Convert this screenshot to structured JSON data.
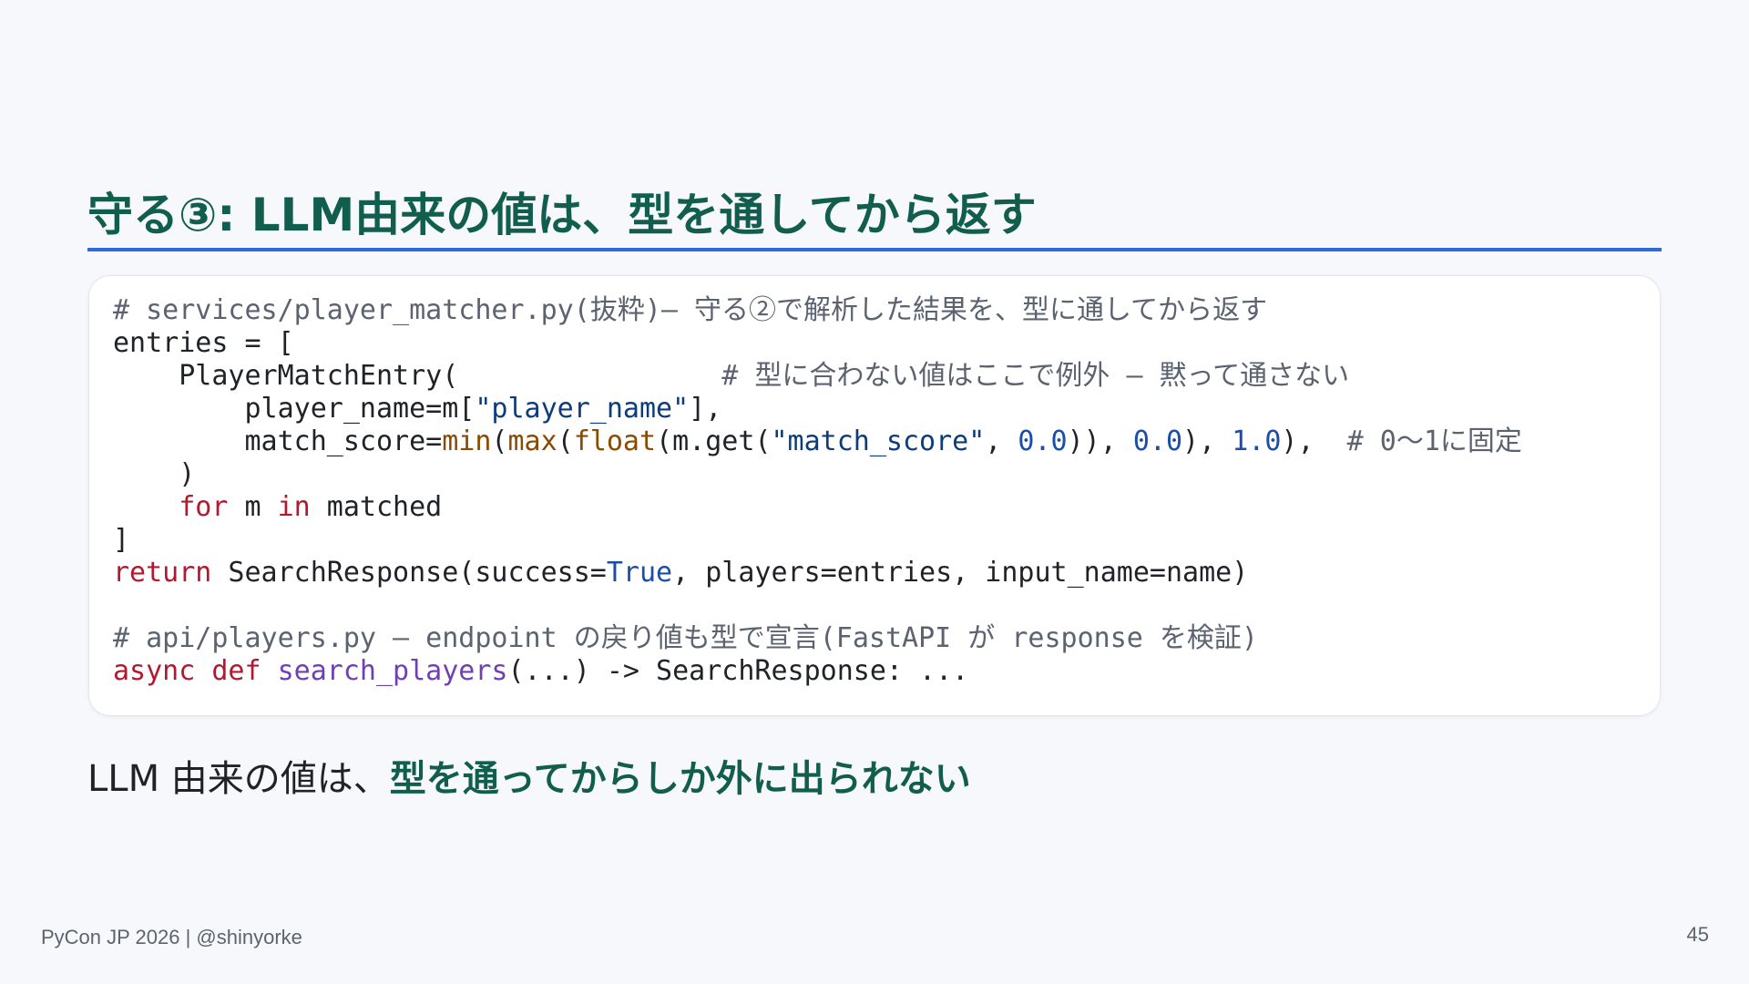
{
  "slide": {
    "title": "守る③: LLM由来の値は、型を通してから返す",
    "footer": "PyCon JP 2026 | @shinyorke",
    "page_number": "45"
  },
  "code": {
    "lines": [
      [
        {
          "t": "# services/player_matcher.py(抜粋)— 守る②で解析した結果を、型に通してから返す",
          "c": "comment"
        }
      ],
      [
        {
          "t": "entries = [",
          "c": "plain"
        }
      ],
      [
        {
          "t": "    PlayerMatchEntry(",
          "c": "plain"
        },
        {
          "t": "                # 型に合わない値はここで例外 — 黙って通さない",
          "c": "comment"
        }
      ],
      [
        {
          "t": "        player_name=m[",
          "c": "plain"
        },
        {
          "t": "\"player_name\"",
          "c": "str"
        },
        {
          "t": "],",
          "c": "plain"
        }
      ],
      [
        {
          "t": "        match_score=",
          "c": "plain"
        },
        {
          "t": "min",
          "c": "builtin"
        },
        {
          "t": "(",
          "c": "plain"
        },
        {
          "t": "max",
          "c": "builtin"
        },
        {
          "t": "(",
          "c": "plain"
        },
        {
          "t": "float",
          "c": "builtin"
        },
        {
          "t": "(m.get(",
          "c": "plain"
        },
        {
          "t": "\"match_score\"",
          "c": "str"
        },
        {
          "t": ", ",
          "c": "plain"
        },
        {
          "t": "0.0",
          "c": "num"
        },
        {
          "t": ")), ",
          "c": "plain"
        },
        {
          "t": "0.0",
          "c": "num"
        },
        {
          "t": "), ",
          "c": "plain"
        },
        {
          "t": "1.0",
          "c": "num"
        },
        {
          "t": "),  ",
          "c": "plain"
        },
        {
          "t": "# 0〜1に固定",
          "c": "comment"
        }
      ],
      [
        {
          "t": "    )",
          "c": "plain"
        }
      ],
      [
        {
          "t": "    ",
          "c": "plain"
        },
        {
          "t": "for",
          "c": "kw"
        },
        {
          "t": " m ",
          "c": "plain"
        },
        {
          "t": "in",
          "c": "kw"
        },
        {
          "t": " matched",
          "c": "plain"
        }
      ],
      [
        {
          "t": "]",
          "c": "plain"
        }
      ],
      [
        {
          "t": "return",
          "c": "kw"
        },
        {
          "t": " SearchResponse(success=",
          "c": "plain"
        },
        {
          "t": "True",
          "c": "const"
        },
        {
          "t": ", players=entries, input_name=name)",
          "c": "plain"
        }
      ],
      [],
      [
        {
          "t": "# api/players.py — endpoint の戻り値も型で宣言(FastAPI が response を検証)",
          "c": "comment"
        }
      ],
      [
        {
          "t": "async",
          "c": "kw"
        },
        {
          "t": " ",
          "c": "plain"
        },
        {
          "t": "def",
          "c": "kw"
        },
        {
          "t": " ",
          "c": "plain"
        },
        {
          "t": "search_players",
          "c": "func"
        },
        {
          "t": "(...) -> SearchResponse: ...",
          "c": "plain"
        }
      ]
    ]
  },
  "summary": {
    "plain": "LLM 由来の値は、",
    "emphasis": "型を通ってからしか外に出られない"
  },
  "colors": {
    "title": "#115e4f",
    "rule": "#2f6bd6",
    "keyword": "#b3192e",
    "string": "#0d3c7a",
    "number": "#1a4ea8",
    "builtin": "#8a4a00",
    "function": "#6f3fb3",
    "comment": "#5c6370"
  }
}
